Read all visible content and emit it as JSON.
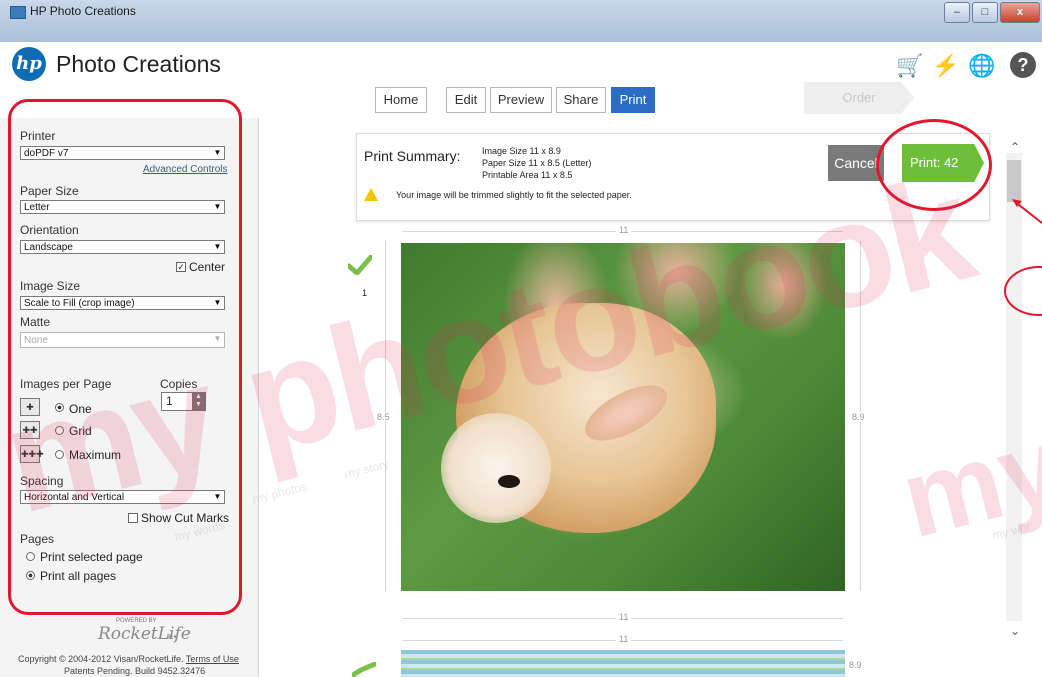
{
  "window": {
    "title": "HP Photo Creations",
    "controls": {
      "minimize": "–",
      "maximize": "□",
      "close": "x"
    }
  },
  "app": {
    "logo_text": "hp",
    "title": "Photo Creations",
    "icons": [
      "cart-icon",
      "lightning-icon",
      "globe-icon",
      "help-icon"
    ],
    "help_glyph": "?"
  },
  "nav": {
    "tabs": [
      "Home",
      "Edit",
      "Preview",
      "Share",
      "Print"
    ],
    "active": "Print",
    "order_label": "Order"
  },
  "sidebar": {
    "printer_label": "Printer",
    "printer_value": "doPDF v7",
    "advanced_controls": "Advanced Controls",
    "paper_size_label": "Paper Size",
    "paper_size_value": "Letter",
    "orientation_label": "Orientation",
    "orientation_value": "Landscape",
    "center_label": "Center",
    "center_checked": true,
    "image_size_label": "Image Size",
    "image_size_value": "Scale to Fill (crop image)",
    "matte_label": "Matte",
    "matte_value": "None",
    "images_per_page_label": "Images per Page",
    "copies_label": "Copies",
    "copies_value": "1",
    "per_page_options": [
      "One",
      "Grid",
      "Maximum"
    ],
    "per_page_selected": "One",
    "spacing_label": "Spacing",
    "spacing_value": "Horizontal and Vertical",
    "show_cut_marks": "Show Cut Marks",
    "pages_label": "Pages",
    "pages_options": [
      "Print selected page",
      "Print all pages"
    ],
    "pages_selected": "Print all pages",
    "powered_by": "POWERED BY",
    "rocketlife": "RocketLife",
    "copyright": "Copyright © 2004-2012 Visan/RocketLife.",
    "terms": "Terms of Use",
    "patents": "Patents Pending. Build 9452.32476"
  },
  "summary": {
    "title": "Print Summary:",
    "image_size": "Image Size 11 x 8.9",
    "paper_size": "Paper Size 11 x 8.5 (Letter)",
    "printable_area": "Printable Area 11 x 8.5",
    "warning": "Your image will be trimmed slightly to fit the selected paper.",
    "cancel_label": "Cancel",
    "print_label": "Print: 42"
  },
  "preview": {
    "page_number": "1",
    "width_top": "11",
    "width_bottom": "11",
    "height_left": "8.5",
    "height_right": "8.9",
    "next_width": "11",
    "next_height": "8.9",
    "photo_desc_icon": "photo-rabbit"
  },
  "watermark": {
    "text": "my photobook",
    "small_1": "my photos",
    "small_2": "my story",
    "small_3": "my words",
    "small_4": "my wor"
  },
  "colors": {
    "accent_blue": "#2b6cc4",
    "print_green": "#6fbe3a",
    "annotation_red": "#e0182b",
    "hp_blue": "#0e6cb3"
  }
}
